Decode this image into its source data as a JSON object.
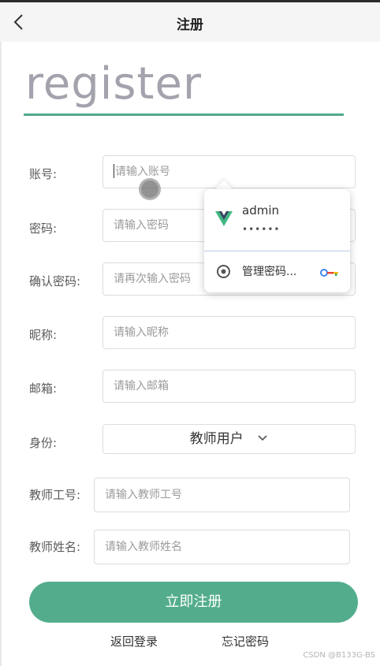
{
  "header": {
    "title": "注册",
    "back_icon": "chevron-left-icon"
  },
  "hero": {
    "title": "register"
  },
  "form": {
    "account": {
      "label": "账号:",
      "placeholder": "请输入账号"
    },
    "password": {
      "label": "密码:",
      "placeholder": "请输入密码"
    },
    "confirm": {
      "label": "确认密码:",
      "placeholder": "请再次输入密码"
    },
    "nickname": {
      "label": "昵称:",
      "placeholder": "请输入昵称"
    },
    "email": {
      "label": "邮箱:",
      "placeholder": "请输入邮箱"
    },
    "role": {
      "label": "身份:",
      "value": "教师用户"
    },
    "teacher_id": {
      "label": "教师工号:",
      "placeholder": "请输入教师工号"
    },
    "teacher_name": {
      "label": "教师姓名:",
      "placeholder": "请输入教师姓名"
    }
  },
  "autofill": {
    "username": "admin",
    "password_mask": "••••••",
    "manage_label": "管理密码...",
    "icons": [
      "vue-logo-icon",
      "chrome-icon",
      "key-icon"
    ]
  },
  "actions": {
    "submit": "立即注册",
    "back_to_login": "返回登录",
    "forgot_password": "忘记密码"
  },
  "watermark": "CSDN @B133G-BS",
  "colors": {
    "accent": "#53ad8c",
    "underline": "#53a98a",
    "title_gray": "#a3a3ad"
  }
}
